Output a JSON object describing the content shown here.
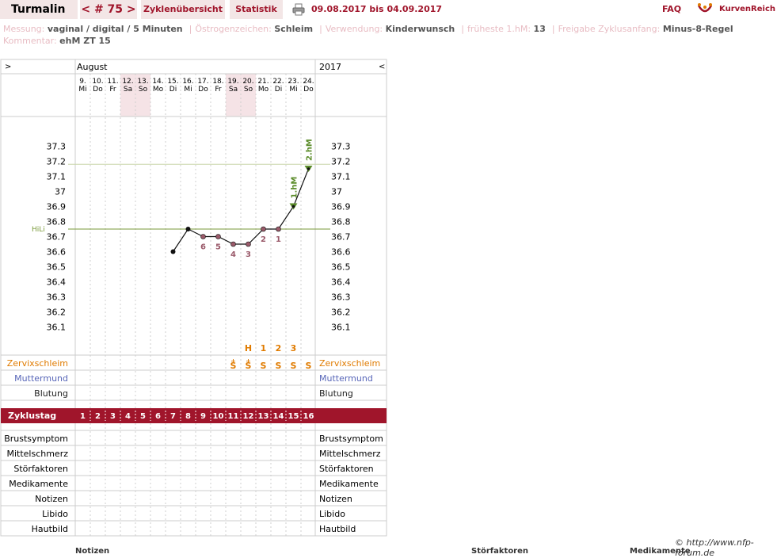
{
  "header": {
    "chart_name": "Turmalin",
    "cycle_nav": "< # 75 >",
    "tab_overview": "Zyklenübersicht",
    "tab_stats": "Statistik",
    "date_range": "09.08.2017 bis 04.09.2017",
    "faq": "FAQ",
    "brand": "KurvenReich"
  },
  "info_line1": [
    {
      "label": "Messung:",
      "value": "vaginal / digital / 5 Minuten"
    },
    {
      "label": "Östrogenzeichen:",
      "value": "Schleim"
    },
    {
      "label": "Verwendung:",
      "value": "Kinderwunsch"
    },
    {
      "label": "früheste 1.hM:",
      "value": "13"
    },
    {
      "label": "Freigabe Zyklusanfang:",
      "value": "Minus-8-Regel"
    }
  ],
  "info_line2": [
    {
      "label": "Kommentar:",
      "value": "ehM ZT 15"
    }
  ],
  "chart": {
    "nav_prev": ">",
    "nav_next": "<",
    "month": "August",
    "year": "2017",
    "days": [
      {
        "date": "9.",
        "wd": "Mi"
      },
      {
        "date": "10.",
        "wd": "Do"
      },
      {
        "date": "11.",
        "wd": "Fr"
      },
      {
        "date": "12.",
        "wd": "Sa"
      },
      {
        "date": "13.",
        "wd": "So"
      },
      {
        "date": "14.",
        "wd": "Mo"
      },
      {
        "date": "15.",
        "wd": "Di"
      },
      {
        "date": "16.",
        "wd": "Mi"
      },
      {
        "date": "17.",
        "wd": "Do"
      },
      {
        "date": "18.",
        "wd": "Fr"
      },
      {
        "date": "19.",
        "wd": "Sa"
      },
      {
        "date": "20.",
        "wd": "So"
      },
      {
        "date": "21.",
        "wd": "Mo"
      },
      {
        "date": "22.",
        "wd": "Di"
      },
      {
        "date": "23.",
        "wd": "Mi"
      },
      {
        "date": "24.",
        "wd": "Do"
      }
    ],
    "weekend_indices": [
      3,
      4,
      10,
      11
    ],
    "ylim": [
      36.1,
      37.3
    ],
    "yticks": [
      "37.3",
      "37.2",
      "37.1",
      "37",
      "36.9",
      "36.8",
      "36.7",
      "36.6",
      "36.5",
      "36.4",
      "36.3",
      "36.2",
      "36.1"
    ],
    "hili_label": "HiLi",
    "hili_value": 36.75,
    "ehm_value": 37.18,
    "temps": [
      {
        "day": 7,
        "value": 36.6
      },
      {
        "day": 8,
        "value": 36.75
      },
      {
        "day": 9,
        "value": 36.7,
        "label": "6"
      },
      {
        "day": 10,
        "value": 36.7,
        "label": "5"
      },
      {
        "day": 11,
        "value": 36.65,
        "label": "4"
      },
      {
        "day": 12,
        "value": 36.65,
        "label": "3"
      },
      {
        "day": 13,
        "value": 36.75,
        "label": "2"
      },
      {
        "day": 14,
        "value": 36.75,
        "label": "1"
      },
      {
        "day": 15,
        "value": 36.9,
        "marker": "1.hM"
      },
      {
        "day": 16,
        "value": 37.15,
        "marker": "2.hM"
      }
    ],
    "mucus_peak": [
      {
        "day": 12,
        "text": "H"
      },
      {
        "day": 13,
        "text": "1"
      },
      {
        "day": 14,
        "text": "2"
      },
      {
        "day": 15,
        "text": "3"
      }
    ],
    "mucus": [
      {
        "day": 11,
        "text": "S",
        "plus": "+"
      },
      {
        "day": 12,
        "text": "S",
        "plus": "+"
      },
      {
        "day": 13,
        "text": "S"
      },
      {
        "day": 14,
        "text": "S"
      },
      {
        "day": 15,
        "text": "S"
      },
      {
        "day": 16,
        "text": "S"
      }
    ],
    "rows_top": [
      {
        "name": "Zervixschleim",
        "color": "#e07b00"
      },
      {
        "name": "Muttermund",
        "color": "#5866b8"
      },
      {
        "name": "Blutung",
        "color": "#222"
      }
    ],
    "cycle_label": "Zyklustag",
    "cycle_days": [
      "1",
      "2",
      "3",
      "4",
      "5",
      "6",
      "7",
      "8",
      "9",
      "10",
      "11",
      "12",
      "13",
      "14",
      "15",
      "16"
    ],
    "rows_bottom": [
      "Brustsymptom",
      "Mittelschmerz",
      "Störfaktoren",
      "Medikamente",
      "Notizen",
      "Libido",
      "Hautbild"
    ]
  },
  "footer": {
    "copyright": "© http://www.nfp-forum.de",
    "col_notes": "Notizen",
    "col_factors": "Störfaktoren",
    "col_meds": "Medikamente"
  },
  "colors": {
    "accent": "#a0152b",
    "tab_bg": "#f3e6e6",
    "grid": "#cccccc",
    "weekend": "#f5e3e6",
    "hili": "#7a9a3a",
    "marker": "#5b8c2a",
    "low_point": "#9a5a6a",
    "mucus": "#e07b00"
  }
}
